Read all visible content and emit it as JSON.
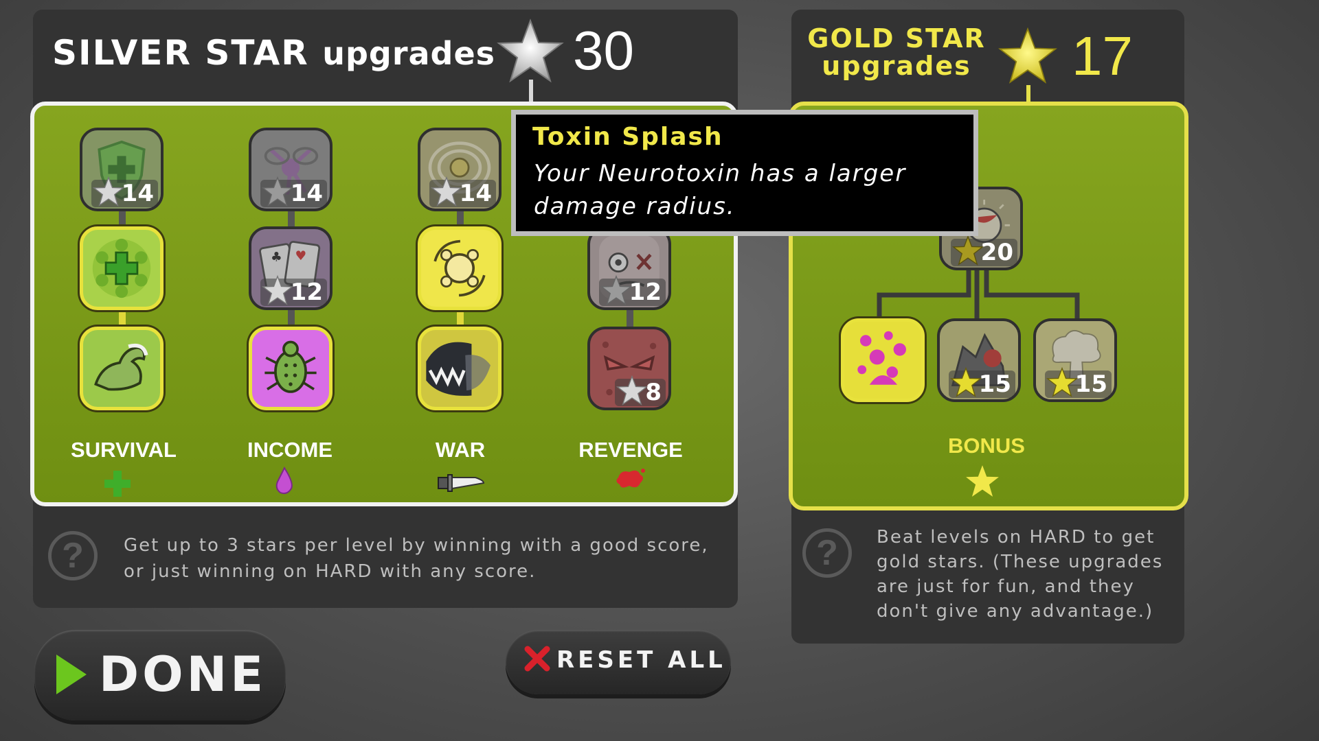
{
  "silver": {
    "title_main": "SILVER STAR",
    "title_sub": "upgrades",
    "star_count": "30",
    "help_text": "Get up to 3 stars per level by winning with a good score, or just winning on HARD with any score.",
    "categories": [
      {
        "label": "SURVIVAL",
        "icon": "plus-icon",
        "color": "#3fae2a"
      },
      {
        "label": "INCOME",
        "icon": "drop-icon",
        "color": "#c44fd1"
      },
      {
        "label": "WAR",
        "icon": "knife-icon",
        "color": "#dddddd"
      },
      {
        "label": "REVENGE",
        "icon": "splat-icon",
        "color": "#d8282f"
      }
    ],
    "tiles": [
      {
        "cost": "14",
        "state": "locked",
        "icon": "shield-plus-icon"
      },
      {
        "cost": "",
        "state": "owned",
        "icon": "cell-plus-icon"
      },
      {
        "cost": "",
        "state": "owned",
        "icon": "muscle-arm-icon"
      },
      {
        "cost": "14",
        "state": "locked",
        "icon": "splash-icon"
      },
      {
        "cost": "12",
        "state": "locked",
        "icon": "cards-icon"
      },
      {
        "cost": "",
        "state": "owned",
        "icon": "bug-icon"
      },
      {
        "cost": "14",
        "state": "locked",
        "icon": "virus-ring-icon"
      },
      {
        "cost": "",
        "state": "owned",
        "icon": "virus-cycle-icon"
      },
      {
        "cost": "",
        "state": "owned",
        "icon": "teeth-icon"
      },
      {
        "cost": "12",
        "state": "locked",
        "icon": "zombie-face-icon"
      },
      {
        "cost": "8",
        "state": "locked",
        "icon": "angry-face-icon"
      }
    ]
  },
  "gold": {
    "title_line1": "GOLD STAR",
    "title_line2": "upgrades",
    "star_count": "17",
    "help_text": "Beat levels on HARD to get gold stars. (These upgrades are just for fun, and they don't give any advantage.)",
    "category": "BONUS",
    "tiles": [
      {
        "cost": "20",
        "state": "locked",
        "icon": "ball-icon"
      },
      {
        "cost": "",
        "state": "owned",
        "icon": "paint-splatter-icon"
      },
      {
        "cost": "15",
        "state": "locked",
        "icon": "monster-icon"
      },
      {
        "cost": "15",
        "state": "locked",
        "icon": "explosion-icon"
      }
    ]
  },
  "tooltip": {
    "title": "Toxin Splash",
    "description": "Your Neurotoxin has a larger damage radius."
  },
  "buttons": {
    "done": "DONE",
    "reset_all": "RESET ALL"
  },
  "colors": {
    "board_green": "#7e9c1b",
    "gold_accent": "#f1e84a",
    "silver_white": "#ffffff",
    "done_arrow": "#6cc61e",
    "reset_x": "#d9212b"
  }
}
